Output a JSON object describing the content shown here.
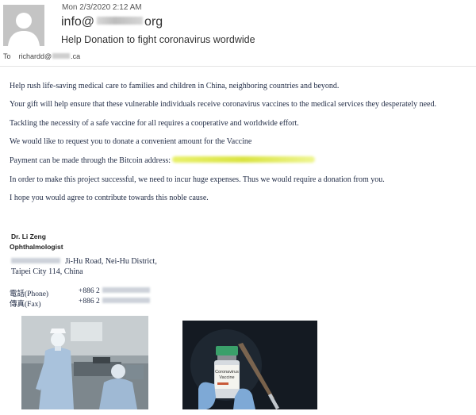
{
  "email": {
    "date": "Mon 2/3/2020 2:12 AM",
    "from_prefix": "info@",
    "from_suffix": "org",
    "subject": "Help Donation to fight  coronavirus wordwide",
    "to_label": "To",
    "to_prefix": "richardd@",
    "to_suffix": ".ca"
  },
  "body": {
    "paragraphs": [
      "Help rush life-saving medical care to families and children in China, neighboring countries and beyond.",
      "Your gift will help ensure that these vulnerable individuals receive coronavirus vaccines to the medical services they desperately need.",
      "Tackling the necessity of a safe vaccine for all requires a cooperative and worldwide effort.",
      "We would like to request you to donate a convenient amount for the Vaccine",
      "Payment can be made through the Bitcoin address:",
      "In order to make this project successful, we need to incur huge expenses. Thus we would require a donation from you.",
      "I hope you would agree to contribute towards this noble cause."
    ]
  },
  "signature": {
    "name": "Dr. Li  Zeng",
    "title": "Ophthalmologist",
    "address_line1": "Ji-Hu Road, Nei-Hu District,",
    "address_line2": "Taipei City 114, China",
    "phone_label": "電話(Phone)",
    "phone_value": "+886 2",
    "fax_label": "傳真(Fax)",
    "fax_value": "+886 2"
  },
  "images": {
    "left_icon": "medical-workers-ppe-image",
    "right_icon": "coronavirus-vaccine-vial-image",
    "vial_label_line1": "Coronavirus",
    "vial_label_line2": "Vaccine"
  },
  "colors": {
    "body_text": "#1f2a44",
    "highlight": "#e4ec55",
    "avatar_bg": "#c4c4c4"
  }
}
